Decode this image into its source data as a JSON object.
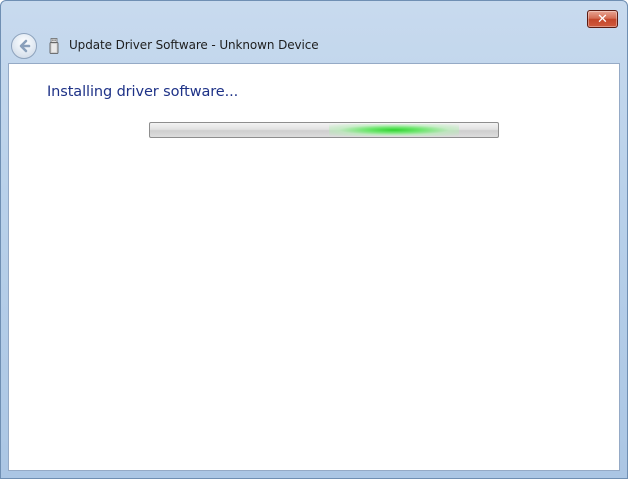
{
  "window": {
    "title": "Update Driver Software - Unknown Device",
    "close_label": "✕"
  },
  "icons": {
    "back": "back-arrow-icon",
    "device": "usb-device-icon",
    "close": "close-icon"
  },
  "main": {
    "heading": "Installing driver software...",
    "progress": {
      "mode": "indeterminate",
      "marquee_position": 0.7
    }
  },
  "colors": {
    "heading": "#1e3287",
    "progress_glow": "#2fd32f",
    "close_button": "#c3462a",
    "title_bar": "#b9d1ea"
  }
}
